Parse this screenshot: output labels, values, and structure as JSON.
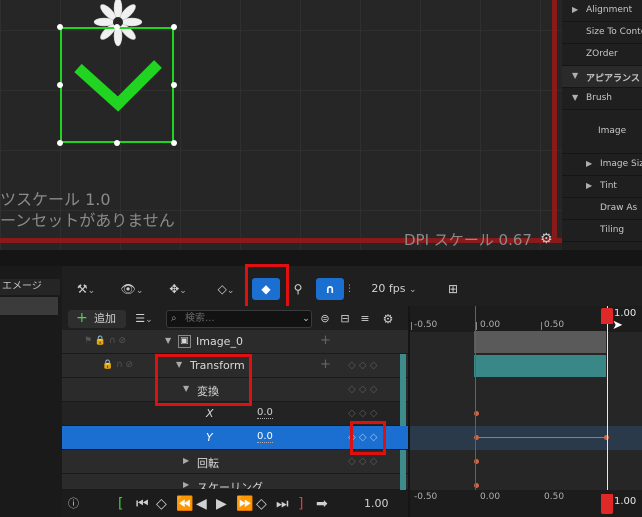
{
  "viewport": {
    "texts": [
      "ツスケール 1.0",
      "ーンセットがありません"
    ],
    "dpi_label": "DPI スケール 0.67"
  },
  "details": {
    "rows": [
      {
        "label": "Alignment",
        "type": "collapsed"
      },
      {
        "label": "Size To Conte",
        "type": "prop"
      },
      {
        "label": "ZOrder",
        "type": "prop"
      },
      {
        "label": "アピアランス",
        "type": "section"
      },
      {
        "label": "Brush",
        "type": "expanded"
      },
      {
        "label": "Image",
        "type": "prop-tall"
      },
      {
        "label": "Image Siz",
        "type": "collapsed"
      },
      {
        "label": "Tint",
        "type": "collapsed"
      },
      {
        "label": "Draw As",
        "type": "prop"
      },
      {
        "label": "Tiling",
        "type": "prop"
      }
    ]
  },
  "left_panel": {
    "tab": "エメージ"
  },
  "toolbar": {
    "fps": "20 fps"
  },
  "tracklist": {
    "add_label": "追加",
    "search_placeholder": "検索...",
    "tracks": [
      {
        "name": "Image_0",
        "indent": 0
      },
      {
        "name": "Transform",
        "indent": 1
      },
      {
        "name": "変換",
        "indent": 2
      },
      {
        "name": "X",
        "value": "0.0",
        "indent": 3
      },
      {
        "name": "Y",
        "value": "0.0",
        "indent": 3,
        "selected": true
      },
      {
        "name": "回転",
        "indent": 2
      },
      {
        "name": "スケーリング",
        "indent": 2
      }
    ]
  },
  "timeline": {
    "ticks": [
      "-0.50",
      "0.00",
      "0.50",
      "1.00"
    ],
    "playhead_label": "1.00"
  },
  "transport": {
    "time": "1.00"
  },
  "colors": {
    "accent": "#1a6fd1",
    "selected_row": "#1a6fd1",
    "highlight_box": "#e01010",
    "widget_green": "#22d422"
  }
}
